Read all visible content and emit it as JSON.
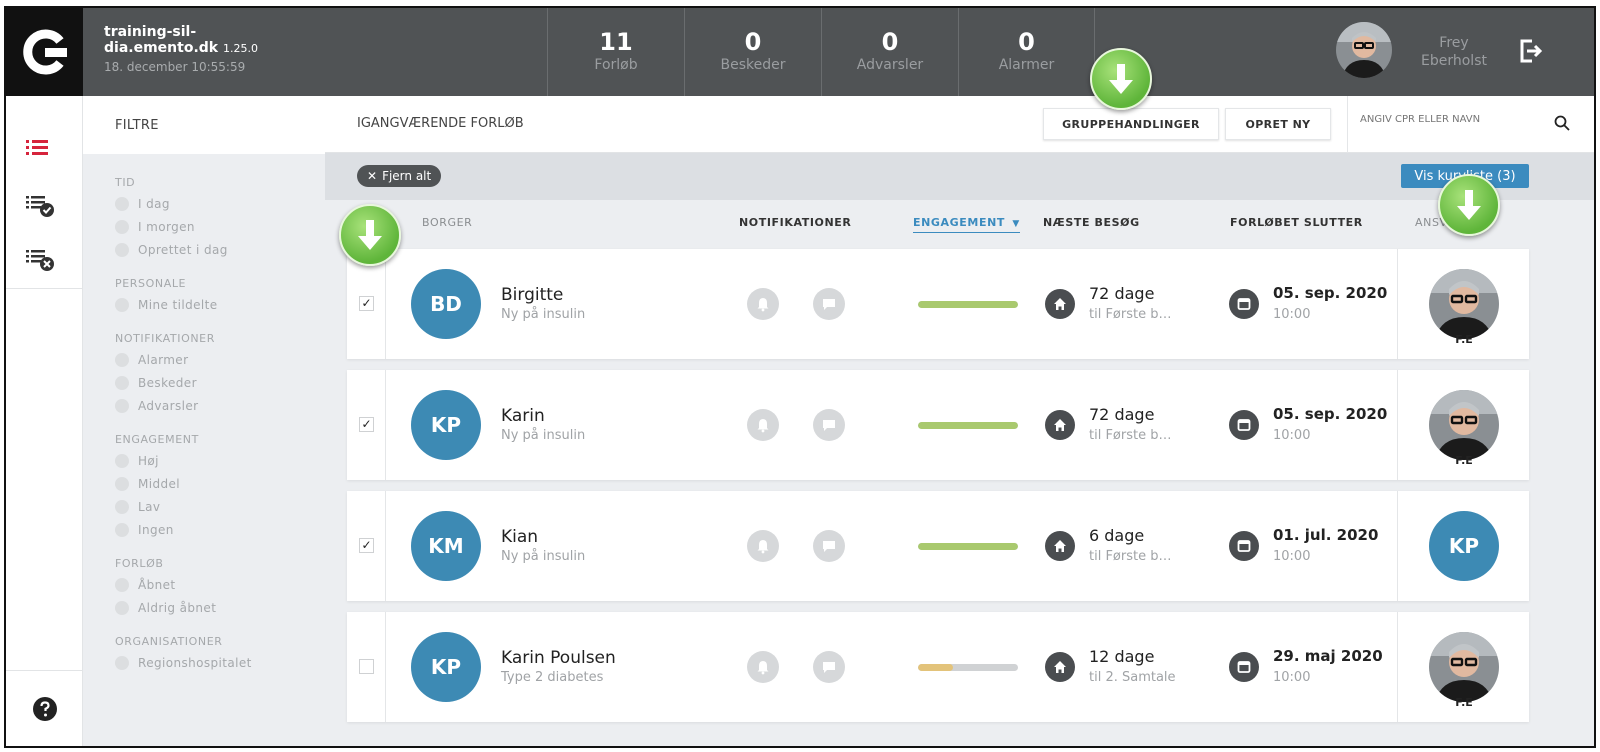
{
  "header": {
    "site_name_line1": "training-sil-",
    "site_name_line2": "dia.emento.dk",
    "version": "1.25.0",
    "datetime": "18. december 10:55:59",
    "stats": [
      {
        "value": "11",
        "label": "Forløb"
      },
      {
        "value": "0",
        "label": "Beskeder"
      },
      {
        "value": "0",
        "label": "Advarsler"
      },
      {
        "value": "0",
        "label": "Alarmer"
      }
    ],
    "user_first": "Frey",
    "user_last": "Eberholst"
  },
  "filters": {
    "title": "FILTRE",
    "groups": [
      {
        "title": "TID",
        "items": [
          "I dag",
          "I morgen",
          "Oprettet i dag"
        ]
      },
      {
        "title": "PERSONALE",
        "items": [
          "Mine tildelte"
        ]
      },
      {
        "title": "NOTIFIKATIONER",
        "items": [
          "Alarmer",
          "Beskeder",
          "Advarsler"
        ]
      },
      {
        "title": "ENGAGEMENT",
        "items": [
          "Høj",
          "Middel",
          "Lav",
          "Ingen"
        ]
      },
      {
        "title": "FORLØB",
        "items": [
          "Åbnet",
          "Aldrig åbnet"
        ]
      },
      {
        "title": "ORGANISATIONER",
        "items": [
          "Regionshospitalet"
        ]
      }
    ]
  },
  "main": {
    "title": "IGANGVÆRENDE FORLØB",
    "group_actions_label": "GRUPPEHANDLINGER",
    "create_label": "OPRET NY",
    "search_placeholder": "ANGIV CPR ELLER NAVN",
    "clear_chip": "Fjern alt",
    "show_button": "Vis kurvliste (3)",
    "columns": {
      "borger": "BORGER",
      "notifikationer": "NOTIFIKATIONER",
      "engagement": "ENGAGEMENT",
      "naeste": "NÆSTE BESØG",
      "slutter": "FORLØBET SLUTTER",
      "ansvarlig": "ANSVARLIG"
    }
  },
  "rows": [
    {
      "checked": true,
      "initials": "BD",
      "name": "Birgitte",
      "sub": "Ny på insulin",
      "engagement": 1.0,
      "engagement_color": "#a9c96e",
      "next_value": "72 dage",
      "next_sub": "til Første b…",
      "end_date": "05. sep. 2020",
      "end_time": "10:00",
      "resp_type": "photo",
      "resp_initials": "F.E"
    },
    {
      "checked": true,
      "initials": "KP",
      "name": "Karin",
      "sub": "Ny på insulin",
      "engagement": 1.0,
      "engagement_color": "#a9c96e",
      "next_value": "72 dage",
      "next_sub": "til Første b…",
      "end_date": "05. sep. 2020",
      "end_time": "10:00",
      "resp_type": "photo",
      "resp_initials": "F.E"
    },
    {
      "checked": true,
      "initials": "KM",
      "name": "Kian",
      "sub": "Ny på insulin",
      "engagement": 1.0,
      "engagement_color": "#a9c96e",
      "next_value": "6 dage",
      "next_sub": "til Første b…",
      "end_date": "01. jul. 2020",
      "end_time": "10:00",
      "resp_type": "initials",
      "resp_initials": "KP"
    },
    {
      "checked": false,
      "initials": "KP",
      "name": "Karin Poulsen",
      "sub": "Type 2 diabetes",
      "engagement": 0.35,
      "engagement_color": "#e3c37a",
      "next_value": "12 dage",
      "next_sub": "til 2. Samtale",
      "end_date": "29. maj 2020",
      "end_time": "10:00",
      "resp_type": "photo",
      "resp_initials": "F.E"
    }
  ],
  "colors": {
    "accent": "#3b8bbf",
    "header_bg": "#505355",
    "nav_active": "#d6243c",
    "highlight_arrow": "#5fb53a"
  }
}
